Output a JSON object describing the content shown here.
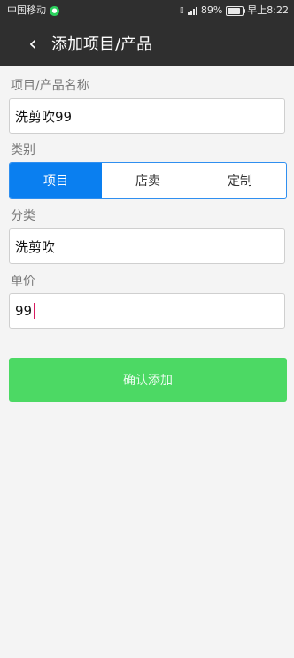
{
  "status_bar": {
    "carrier": "中国移动",
    "battery": "89%",
    "time": "早上8:22"
  },
  "header": {
    "title": "添加项目/产品"
  },
  "form": {
    "name_label": "项目/产品名称",
    "name_value": "洗剪吹99",
    "type_label": "类别",
    "type_options": [
      {
        "label": "项目",
        "selected": true
      },
      {
        "label": "店卖",
        "selected": false
      },
      {
        "label": "定制",
        "selected": false
      }
    ],
    "category_label": "分类",
    "category_value": "洗剪吹",
    "price_label": "单价",
    "price_value": "99",
    "submit_label": "确认添加"
  },
  "colors": {
    "header_bg": "#2f2f2f",
    "segment_active": "#0a7ff0",
    "submit_bg": "#4cd964"
  }
}
